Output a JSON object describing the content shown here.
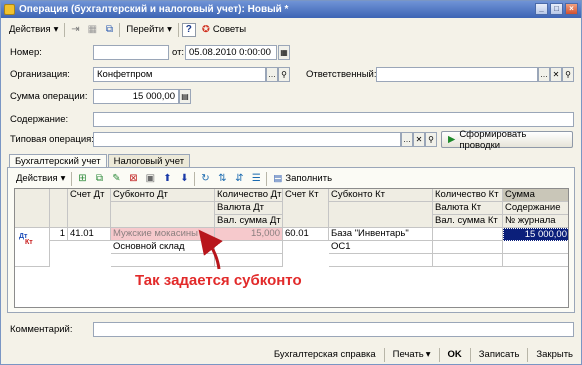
{
  "window": {
    "title": "Операция (бухгалтерский и налоговый учет): Новый *",
    "controls": [
      "_",
      "□",
      "×"
    ]
  },
  "toolbar": {
    "actions_label": "Действия",
    "goto_label": "Перейти",
    "help_label": "?",
    "tips_label": "Советы"
  },
  "form": {
    "number_label": "Номер:",
    "number_value": "",
    "date_from_label": "от:",
    "date_value": "05.08.2010  0:00:00",
    "org_label": "Организация:",
    "org_value": "Конфетпром",
    "responsible_label": "Ответственный:",
    "responsible_value": "",
    "sum_label": "Сумма операции:",
    "sum_value": "15 000,00",
    "content_label": "Содержание:",
    "content_value": "",
    "typical_label": "Типовая операция:",
    "typical_value": "",
    "generate_button": "Сформировать проводки"
  },
  "tabs": [
    {
      "label": "Бухгалтерский учет",
      "active": true
    },
    {
      "label": "Налоговый учет",
      "active": false
    }
  ],
  "grid_toolbar": {
    "actions_label": "Действия",
    "fill_label": "Заполнить"
  },
  "grid": {
    "headers": {
      "account_dt": "Счет Дт",
      "subconto_dt": "Субконто Дт",
      "qty_dt": "Количество Дт",
      "currency_dt": "Валюта Дт",
      "val_sum_dt": "Вал. сумма Дт",
      "account_kt": "Счет Кт",
      "subconto_kt": "Субконто Кт",
      "qty_kt": "Количество Кт",
      "currency_kt": "Валюта Кт",
      "val_sum_kt": "Вал. сумма Кт",
      "amount": "Сумма",
      "content": "Содержание",
      "journal": "№ журнала"
    },
    "row": {
      "icon_top": "Дт",
      "icon_bottom": "Кт",
      "n": "1",
      "account_dt": "41.01",
      "subconto_dt_1": "Мужские мокасины",
      "subconto_dt_2": "Основной склад",
      "qty_dt": "15,000",
      "account_kt": "60.01",
      "subconto_kt_1": "База \"Инвентарь\"",
      "subconto_kt_2": "ОС1",
      "amount": "15 000,00"
    }
  },
  "annotation": "Так задается субконто",
  "comment_label": "Комментарий:",
  "comment_value": "",
  "bottom": {
    "report": "Бухгалтерская справка",
    "print": "Печать",
    "ok": "OK",
    "save": "Записать",
    "close": "Закрыть"
  },
  "colors": {
    "title_bar": "#3c64b4",
    "selection": "#0b1f7a",
    "highlight_pink": "#f6c9cc",
    "annotation_red": "#e22a2a"
  }
}
